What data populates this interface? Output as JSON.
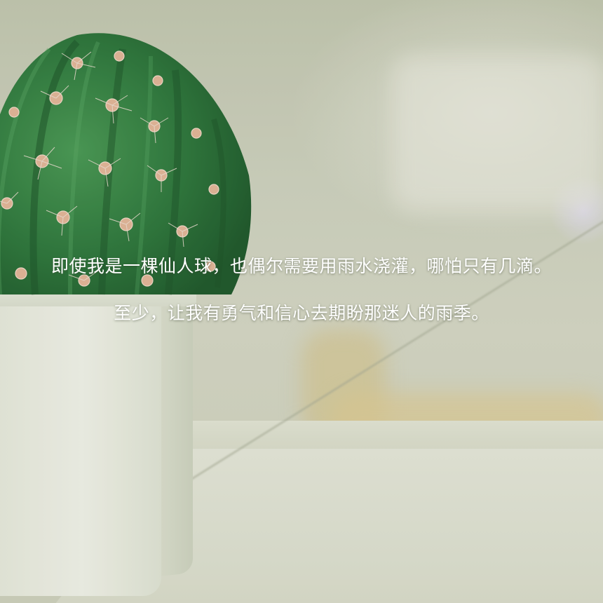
{
  "quote": {
    "line1": "即使我是一棵仙人球，也偶尔需要用雨水浇灌，哪怕只有几滴。",
    "line2": "至少，让我有勇气和信心去期盼那迷人的雨季。"
  },
  "image": {
    "subject": "potted-cactus",
    "colors": {
      "background": "#cfd3c0",
      "cactus_green": "#2f7a3e",
      "spines": "#e4b79a",
      "pot": "#eef0e4",
      "text": "#ffffff"
    }
  }
}
